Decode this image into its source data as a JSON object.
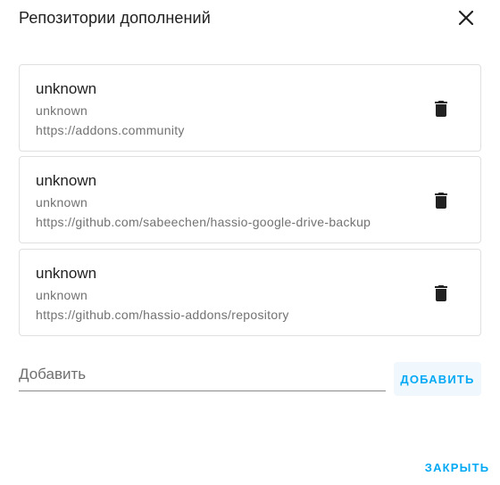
{
  "dialog": {
    "title": "Репозитории дополнений",
    "close_icon": "close-icon"
  },
  "repositories": [
    {
      "name": "unknown",
      "maintainer": "unknown",
      "url": "https://addons.community",
      "delete_icon": "trash-icon"
    },
    {
      "name": "unknown",
      "maintainer": "unknown",
      "url": "https://github.com/sabeechen/hassio-google-drive-backup",
      "delete_icon": "trash-icon"
    },
    {
      "name": "unknown",
      "maintainer": "unknown",
      "url": "https://github.com/hassio-addons/repository",
      "delete_icon": "trash-icon"
    }
  ],
  "add": {
    "placeholder": "Добавить",
    "value": "",
    "button_label": "ДОБАВИТЬ"
  },
  "footer": {
    "close_label": "ЗАКРЫТЬ"
  },
  "colors": {
    "accent": "#03a9f4",
    "text_primary": "#212121",
    "text_secondary": "#727272",
    "border": "#e0e0e0"
  }
}
